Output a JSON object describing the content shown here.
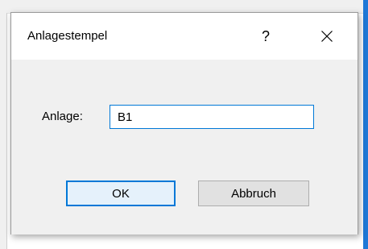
{
  "dialog": {
    "title": "Anlagestempel",
    "help_label": "?",
    "field_label": "Anlage:",
    "field_value": "B1",
    "ok_label": "OK",
    "cancel_label": "Abbruch"
  },
  "icons": {
    "close": "close-icon",
    "help": "help-icon"
  },
  "colors": {
    "accent": "#0078d7",
    "dialog_body": "#f0f0f0",
    "button_face": "#e1e1e1"
  }
}
